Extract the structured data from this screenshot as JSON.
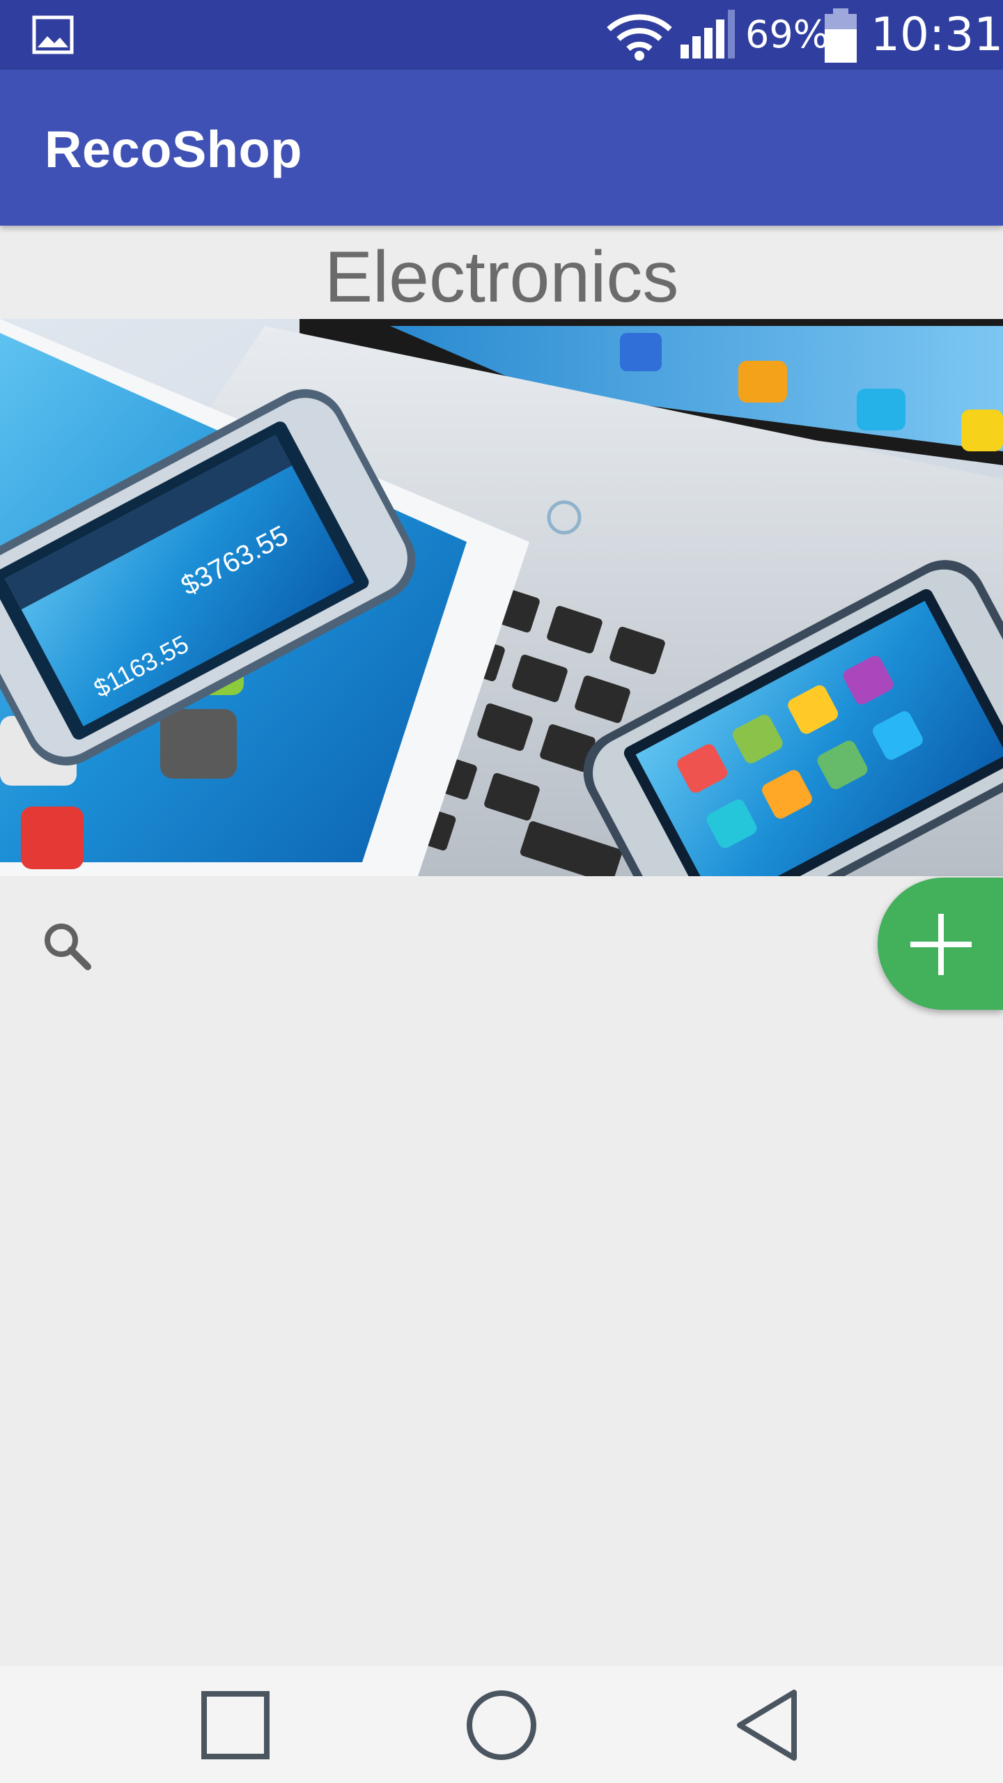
{
  "status_bar": {
    "left_icon": "image-icon",
    "wifi_icon": "wifi-icon",
    "signal_icon": "cell-signal-icon",
    "battery_percent": "69%",
    "battery_icon": "battery-icon",
    "time": "10:31"
  },
  "app_bar": {
    "title": "RecoShop",
    "background_color": "#3f51b5",
    "status_bar_color": "#303f9f"
  },
  "main": {
    "category_title": "Electronics",
    "hero_image": "electronics-devices-image",
    "search": {
      "icon": "search-icon",
      "value": "",
      "placeholder": ""
    },
    "fab": {
      "icon": "plus-icon",
      "color": "#43b05c"
    }
  },
  "nav_bar": {
    "recent_icon": "square-recent-apps-icon",
    "home_icon": "circle-home-icon",
    "back_icon": "triangle-back-icon"
  }
}
